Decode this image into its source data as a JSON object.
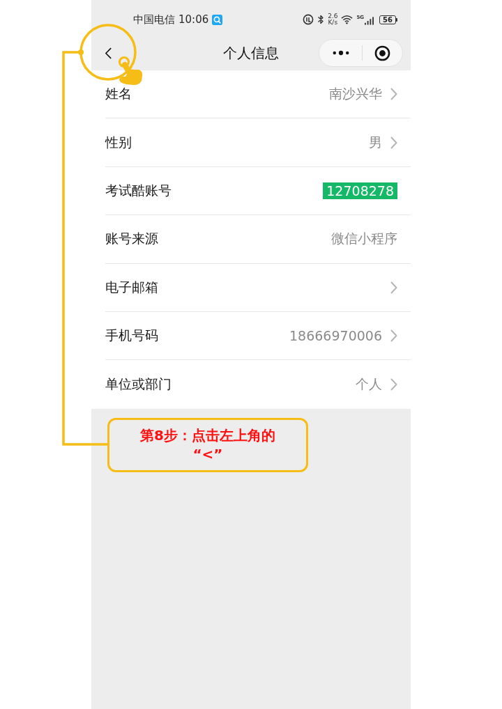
{
  "status_bar": {
    "carrier": "中国电信",
    "time": "10:06",
    "speed_value": "2.6",
    "speed_unit": "K/s",
    "network_type": "5G",
    "battery": "56"
  },
  "nav_bar": {
    "title": "个人信息"
  },
  "rows": [
    {
      "label": "姓名",
      "value": "南沙兴华",
      "chevron": true
    },
    {
      "label": "性别",
      "value": "男",
      "chevron": true
    },
    {
      "label": "考试酷账号",
      "value": "12708278",
      "chevron": false,
      "highlighted": true
    },
    {
      "label": "账号来源",
      "value": "微信小程序",
      "chevron": false
    },
    {
      "label": "电子邮箱",
      "chevron": true
    },
    {
      "label": "手机号码",
      "value": "18666970006",
      "chevron": true
    },
    {
      "label": "单位或部门",
      "value": "个人",
      "chevron": true
    }
  ],
  "callout": {
    "text": "第8步：点击左上角的\n“<”"
  }
}
